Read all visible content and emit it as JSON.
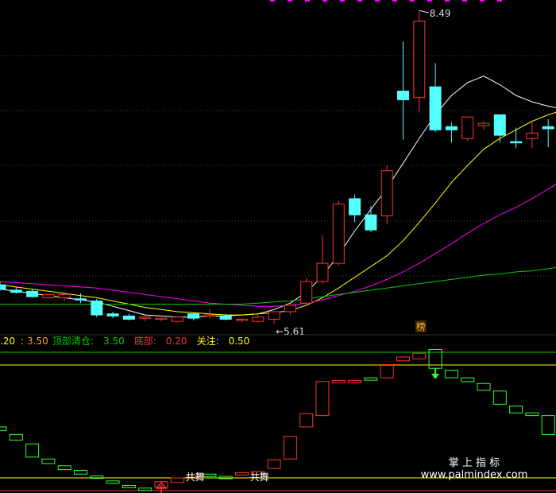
{
  "chart_data": [
    {
      "type": "candlestick",
      "panel": "price",
      "annotations": {
        "high_label": "8.49",
        "low_label": "5.61",
        "badge": "榜"
      },
      "series": [
        {
          "name": "",
          "color": "#ffffff",
          "values": [
            5.88,
            5.86,
            5.84,
            5.82,
            5.8,
            5.78,
            5.76,
            5.72,
            5.68,
            5.64,
            5.63,
            5.62,
            5.62,
            5.63,
            5.63,
            5.64,
            5.65,
            5.69,
            5.75,
            5.85,
            6.0,
            6.2,
            6.42,
            6.62,
            6.82,
            7.05,
            7.28,
            7.5,
            7.68,
            7.8,
            7.86,
            7.78,
            7.68,
            7.62,
            7.58,
            7.55,
            7.5
          ]
        },
        {
          "name": "",
          "color": "#ffff00",
          "values": [
            5.92,
            5.9,
            5.88,
            5.86,
            5.84,
            5.82,
            5.8,
            5.77,
            5.74,
            5.71,
            5.69,
            5.67,
            5.66,
            5.65,
            5.64,
            5.64,
            5.65,
            5.66,
            5.68,
            5.73,
            5.8,
            5.89,
            5.99,
            6.09,
            6.19,
            6.33,
            6.5,
            6.68,
            6.87,
            7.03,
            7.18,
            7.28,
            7.36,
            7.44,
            7.5,
            7.55,
            7.56
          ]
        },
        {
          "name": "",
          "color": "#ff00ff",
          "values": [
            5.95,
            5.94,
            5.93,
            5.92,
            5.91,
            5.9,
            5.89,
            5.87,
            5.85,
            5.83,
            5.81,
            5.79,
            5.77,
            5.75,
            5.74,
            5.73,
            5.72,
            5.72,
            5.73,
            5.75,
            5.78,
            5.82,
            5.86,
            5.91,
            5.97,
            6.04,
            6.12,
            6.21,
            6.3,
            6.4,
            6.49,
            6.57,
            6.64,
            6.72,
            6.81,
            6.9,
            7.0
          ]
        },
        {
          "name": "",
          "color": "#00cc00",
          "values": [
            5.74,
            5.74,
            5.74,
            5.74,
            5.74,
            5.74,
            5.74,
            5.74,
            5.74,
            5.74,
            5.74,
            5.74,
            5.74,
            5.74,
            5.74,
            5.74,
            5.75,
            5.76,
            5.77,
            5.79,
            5.81,
            5.83,
            5.85,
            5.87,
            5.89,
            5.91,
            5.93,
            5.95,
            5.97,
            5.99,
            6.01,
            6.02,
            6.04,
            6.05,
            6.07,
            6.09,
            6.1
          ]
        }
      ],
      "candles": [
        {
          "o": 5.92,
          "h": 5.95,
          "l": 5.86,
          "c": 5.88
        },
        {
          "o": 5.87,
          "h": 5.9,
          "l": 5.84,
          "c": 5.85
        },
        {
          "o": 5.86,
          "h": 5.88,
          "l": 5.8,
          "c": 5.81
        },
        {
          "o": 5.8,
          "h": 5.84,
          "l": 5.79,
          "c": 5.83
        },
        {
          "o": 5.8,
          "h": 5.85,
          "l": 5.77,
          "c": 5.83
        },
        {
          "o": 5.79,
          "h": 5.84,
          "l": 5.75,
          "c": 5.78
        },
        {
          "o": 5.77,
          "h": 5.79,
          "l": 5.62,
          "c": 5.64
        },
        {
          "o": 5.65,
          "h": 5.67,
          "l": 5.61,
          "c": 5.63
        },
        {
          "o": 5.63,
          "h": 5.65,
          "l": 5.59,
          "c": 5.6
        },
        {
          "o": 5.62,
          "h": 5.63,
          "l": 5.58,
          "c": 5.62
        },
        {
          "o": 5.6,
          "h": 5.61,
          "l": 5.58,
          "c": 5.61
        },
        {
          "o": 5.58,
          "h": 5.62,
          "l": 5.57,
          "c": 5.62
        },
        {
          "o": 5.65,
          "h": 5.66,
          "l": 5.59,
          "c": 5.61
        },
        {
          "o": 5.64,
          "h": 5.69,
          "l": 5.61,
          "c": 5.64
        },
        {
          "o": 5.63,
          "h": 5.65,
          "l": 5.59,
          "c": 5.6
        },
        {
          "o": 5.59,
          "h": 5.61,
          "l": 5.57,
          "c": 5.6
        },
        {
          "o": 5.58,
          "h": 5.64,
          "l": 5.57,
          "c": 5.62
        },
        {
          "o": 5.6,
          "h": 5.67,
          "l": 5.56,
          "c": 5.67
        },
        {
          "o": 5.67,
          "h": 5.74,
          "l": 5.64,
          "c": 5.73
        },
        {
          "o": 5.75,
          "h": 5.98,
          "l": 5.73,
          "c": 5.95
        },
        {
          "o": 5.95,
          "h": 6.38,
          "l": 5.93,
          "c": 6.12
        },
        {
          "o": 6.12,
          "h": 6.7,
          "l": 6.1,
          "c": 6.67
        },
        {
          "o": 6.72,
          "h": 6.76,
          "l": 6.5,
          "c": 6.57
        },
        {
          "o": 6.57,
          "h": 6.65,
          "l": 6.41,
          "c": 6.43
        },
        {
          "o": 6.56,
          "h": 7.03,
          "l": 6.48,
          "c": 6.98
        },
        {
          "o": 7.72,
          "h": 8.18,
          "l": 7.27,
          "c": 7.64
        },
        {
          "o": 7.66,
          "h": 8.47,
          "l": 7.52,
          "c": 8.37
        },
        {
          "o": 7.76,
          "h": 7.98,
          "l": 7.34,
          "c": 7.36
        },
        {
          "o": 7.39,
          "h": 7.43,
          "l": 7.24,
          "c": 7.36
        },
        {
          "o": 7.28,
          "h": 7.48,
          "l": 7.26,
          "c": 7.48
        },
        {
          "o": 7.4,
          "h": 7.44,
          "l": 7.36,
          "c": 7.42
        },
        {
          "o": 7.5,
          "h": 7.5,
          "l": 7.24,
          "c": 7.31
        },
        {
          "o": 7.25,
          "h": 7.38,
          "l": 7.19,
          "c": 7.24
        },
        {
          "o": 7.28,
          "h": 7.44,
          "l": 7.19,
          "c": 7.33
        },
        {
          "o": 7.39,
          "h": 7.46,
          "l": 7.2,
          "c": 7.37
        },
        {
          "o": 7.4,
          "h": 7.5,
          "l": 7.33,
          "c": 7.3
        },
        {
          "o": 7.32,
          "h": 7.47,
          "l": 7.29,
          "c": 7.28
        }
      ],
      "ylim": [
        5.5,
        8.53
      ],
      "grid": true
    },
    {
      "type": "bar",
      "panel": "indicator",
      "legend": {
        "first_value": ".20",
        "first_sep": ":",
        "first_sep_value": "3.50",
        "items": [
          {
            "label": "顶部清仓:",
            "value": "3.50",
            "color": "#00cc00"
          },
          {
            "label": "底部:",
            "value": "0.20",
            "color": "#ff3333"
          },
          {
            "label": "关注:",
            "value": "0.50",
            "color": "#ffff00"
          }
        ]
      },
      "reference_lines": [
        {
          "name": "顶部清仓",
          "value": 3.5,
          "color": "#00cc00"
        },
        {
          "name": "关注",
          "value": 0.5,
          "color": "#ffff00"
        },
        {
          "name": "底部",
          "value": 0.2,
          "color": "#ff3333"
        }
      ],
      "signal_texts": [
        "共舞",
        "共舞"
      ],
      "bars": [
        {
          "o": 1.75,
          "c": 1.65
        },
        {
          "o": 1.55,
          "c": 1.4
        },
        {
          "o": 1.3,
          "c": 0.95
        },
        {
          "o": 0.9,
          "c": 0.78
        },
        {
          "o": 0.72,
          "c": 0.62
        },
        {
          "o": 0.6,
          "c": 0.5
        },
        {
          "o": 0.45,
          "c": 0.4
        },
        {
          "o": 0.32,
          "c": 0.28
        },
        {
          "o": 0.2,
          "c": 0.14
        },
        {
          "o": 0.13,
          "c": 0.12
        },
        {
          "o": 0.15,
          "c": 0.3
        },
        {
          "o": 0.28,
          "c": 0.4
        },
        {
          "o": 0.42,
          "c": 0.48
        },
        {
          "o": 0.5,
          "c": 0.46
        },
        {
          "o": 0.44,
          "c": 0.42
        },
        {
          "o": 0.48,
          "c": 0.54
        },
        {
          "o": 0.49,
          "c": 0.57
        },
        {
          "o": 0.65,
          "c": 0.88
        },
        {
          "o": 0.9,
          "c": 1.5
        },
        {
          "o": 1.75,
          "c": 2.1
        },
        {
          "o": 2.05,
          "c": 2.95
        },
        {
          "o": 2.95,
          "c": 2.98
        },
        {
          "o": 2.92,
          "c": 2.98
        },
        {
          "o": 3.05,
          "c": 3.04
        },
        {
          "o": 3.05,
          "c": 3.4
        },
        {
          "o": 3.5,
          "c": 3.6
        },
        {
          "o": 3.55,
          "c": 3.7
        },
        {
          "o": 3.8,
          "c": 3.3
        },
        {
          "o": 3.25,
          "c": 3.05
        },
        {
          "o": 3.05,
          "c": 2.95
        },
        {
          "o": 2.9,
          "c": 2.72
        },
        {
          "o": 2.7,
          "c": 2.35
        },
        {
          "o": 2.3,
          "c": 2.12
        },
        {
          "o": 2.12,
          "c": 2.05
        },
        {
          "o": 2.05,
          "c": 1.55
        },
        {
          "o": 1.45,
          "c": 1.15
        },
        {
          "o": 1.1,
          "c": 0.9
        }
      ],
      "signals": [
        {
          "index": 10,
          "type": "buy"
        },
        {
          "index": 27,
          "type": "sell"
        }
      ]
    }
  ],
  "watermark": {
    "title": "掌 上 指 标",
    "url": "www.palmindex.com"
  }
}
